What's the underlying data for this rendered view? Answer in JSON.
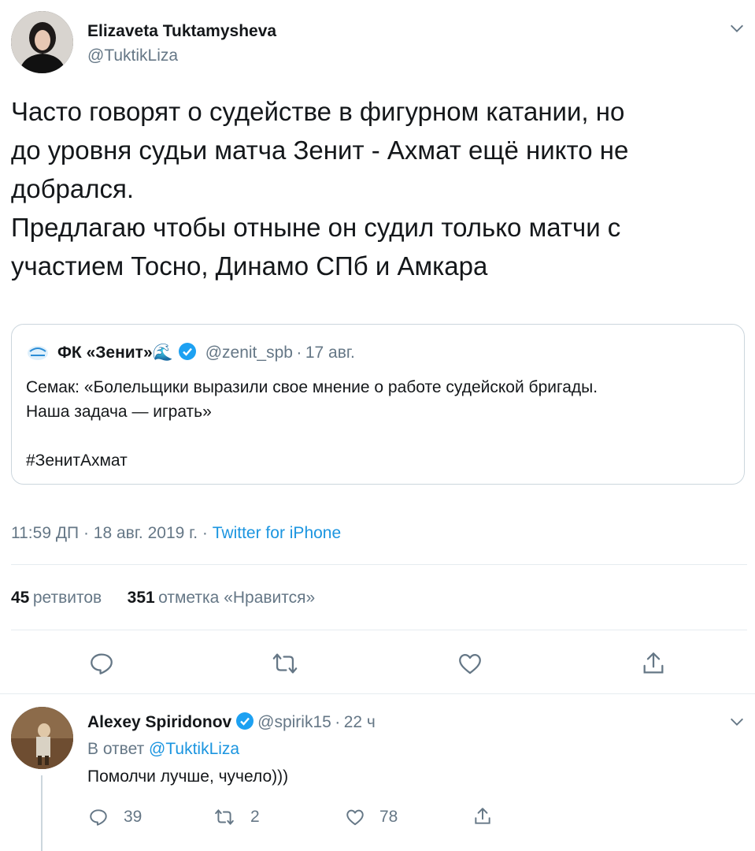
{
  "tweet": {
    "author": {
      "name": "Elizaveta Tuktamysheva",
      "handle": "@TuktikLiza"
    },
    "text_lines": [
      "Часто говорят о судействе в фигурном катании, но",
      "до уровня судьи матча Зенит - Ахмат ещё никто не",
      "добрался.",
      "Предлагаю чтобы отныне он судил только матчи с",
      "участием Тосно, Динамо СПб и Амкара"
    ],
    "quote": {
      "name": "ФК «Зенит»",
      "name_emoji": "🌊",
      "handle": "@zenit_spb",
      "separator": "·",
      "date": "17 авг.",
      "text_lines": [
        "Семак: «Болельщики выразили свое мнение о работе судейской бригады.",
        "Наша задача — играть»"
      ],
      "hashtag": "#ЗенитАхмат"
    },
    "timestamp": "11:59 ДП · 18 авг. 2019 г. · ",
    "source": "Twitter for iPhone",
    "stats": {
      "retweets_count": "45",
      "retweets_label": "ретвитов",
      "likes_count": "351",
      "likes_label": "отметка «Нравится»"
    },
    "icons": [
      "reply-icon",
      "retweet-icon",
      "like-icon",
      "share-icon",
      "chevron-down-icon",
      "verified-icon"
    ]
  },
  "reply": {
    "author": {
      "name": "Alexey Spiridonov",
      "handle": "@spirik15",
      "separator": "·",
      "time": "22 ч"
    },
    "in_reply_prefix": "В ответ",
    "in_reply_handle": "@TuktikLiza",
    "text": "Помолчи лучше, чучело)))",
    "counts": {
      "replies": "39",
      "retweets": "2",
      "likes": "78"
    }
  },
  "colors": {
    "link": "#1b95e0",
    "secondary": "#657786",
    "verified": "#1da1f2",
    "border": "#e6ecf0"
  }
}
